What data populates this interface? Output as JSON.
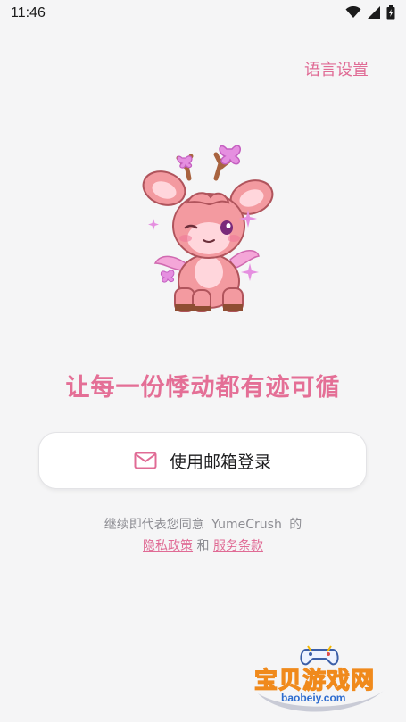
{
  "status_bar": {
    "time": "11:46"
  },
  "header": {
    "language_settings": "语言设置"
  },
  "hero": {
    "slogan": "让每一份悸动都有迹可循"
  },
  "login": {
    "email_login_label": "使用邮箱登录"
  },
  "agreement": {
    "prefix": "继续即代表您同意",
    "app_name": "YumeCrush",
    "suffix": "的",
    "privacy_policy": "隐私政策",
    "and": "和",
    "terms_of_service": "服务条款"
  },
  "watermark": {
    "name": "宝贝游戏网",
    "url": "baobeiy.com"
  },
  "colors": {
    "accent": "#e06b95",
    "background": "#f5f5f6"
  }
}
